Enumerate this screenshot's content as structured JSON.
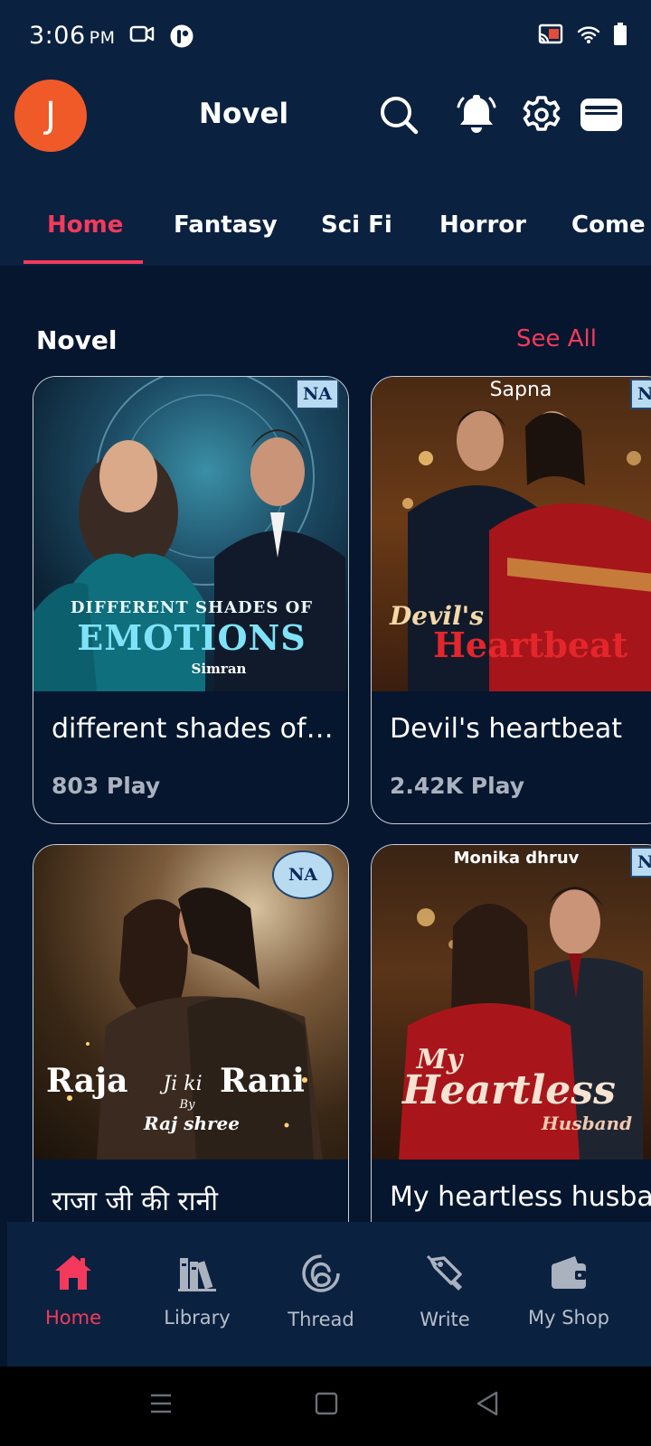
{
  "status": {
    "time": "3:06",
    "ampm": "PM"
  },
  "appbar": {
    "avatar_letter": "J",
    "title": "Novel",
    "accent_color": "#f43a5c",
    "avatar_color": "#f05a28"
  },
  "tabs": [
    {
      "label": "Home",
      "active": true
    },
    {
      "label": "Fantasy"
    },
    {
      "label": "Sci Fi"
    },
    {
      "label": "Horror"
    },
    {
      "label": "Come"
    }
  ],
  "section": {
    "title": "Novel",
    "see_all": "See All"
  },
  "cards": [
    {
      "title": "different shades of ...",
      "plays": "803 Play",
      "cover_title_line1": "DIFFERENT SHADES OF",
      "cover_title_line2": "EMOTIONS",
      "cover_author": "Simran",
      "badge": "NA"
    },
    {
      "title": "Devil's heartbeat",
      "plays": "2.42K Play",
      "cover_title_line1": "Devil's",
      "cover_title_line2": "Heartbeat",
      "cover_author": "Sapna",
      "badge": "NA"
    },
    {
      "title": "राजा जी की रानी",
      "plays": "",
      "cover_title_line1": "Raja",
      "cover_title_middle": "Ji ki",
      "cover_title_line2": "Rani",
      "cover_by": "By",
      "cover_author": "Raj shree",
      "badge": "NA"
    },
    {
      "title": "My heartless husba",
      "plays": "",
      "cover_title_line1": "My",
      "cover_title_line2": "Heartless",
      "cover_title_line3": "Husband",
      "cover_author": "Monika dhruv",
      "badge": "NA"
    }
  ],
  "bottom_nav": [
    {
      "label": "Home",
      "icon": "home-icon",
      "active": true
    },
    {
      "label": "Library",
      "icon": "library-icon"
    },
    {
      "label": "Thread",
      "icon": "thread-icon"
    },
    {
      "label": "Write",
      "icon": "pen-icon"
    },
    {
      "label": "My Shop",
      "icon": "wallet-icon"
    }
  ]
}
